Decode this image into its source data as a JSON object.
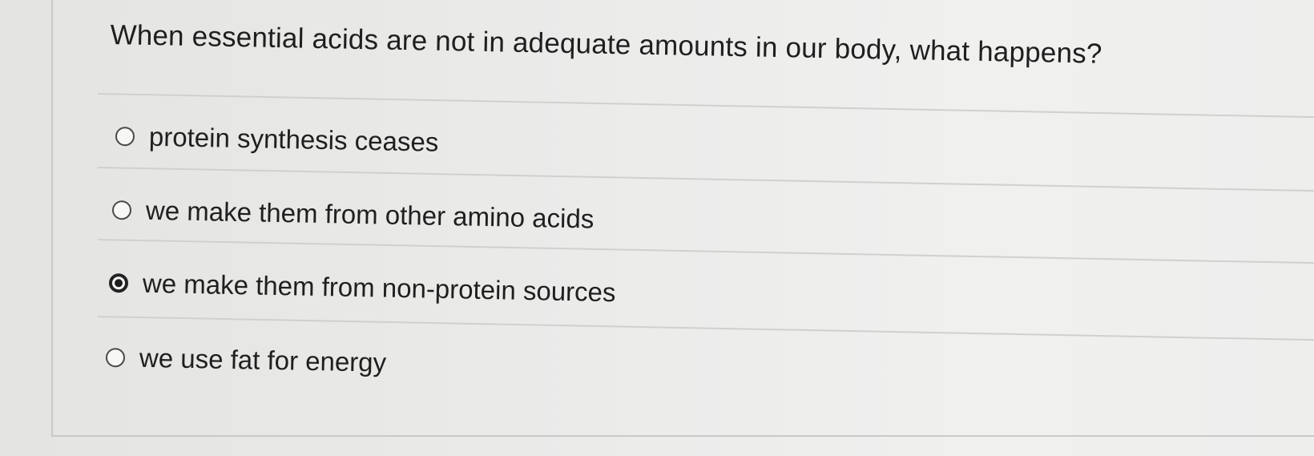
{
  "question": {
    "text": "When essential acids are not in adequate amounts in our body, what happens?"
  },
  "options": [
    {
      "label": "protein synthesis ceases",
      "selected": false
    },
    {
      "label": "we make them from other amino acids",
      "selected": false
    },
    {
      "label": "we make them from non-protein sources",
      "selected": true
    },
    {
      "label": "we use fat for energy",
      "selected": false
    }
  ],
  "colors": {
    "text": "#1f1f1f",
    "radio_border": "#4a4a4a",
    "selected_dot": "#1e1e1e",
    "divider": "#d0d0ce"
  }
}
